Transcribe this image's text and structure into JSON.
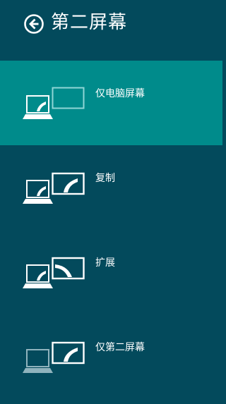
{
  "header": {
    "title": "第二屏幕"
  },
  "options": [
    {
      "label": "仅电脑屏幕",
      "selected": true
    },
    {
      "label": "复制",
      "selected": false
    },
    {
      "label": "扩展",
      "selected": false
    },
    {
      "label": "仅第二屏幕",
      "selected": false
    }
  ],
  "colors": {
    "background": "#034a5c",
    "selected_background": "#008b8b",
    "foreground": "#ffffff",
    "inactive_icon": "#8fb3bd"
  }
}
